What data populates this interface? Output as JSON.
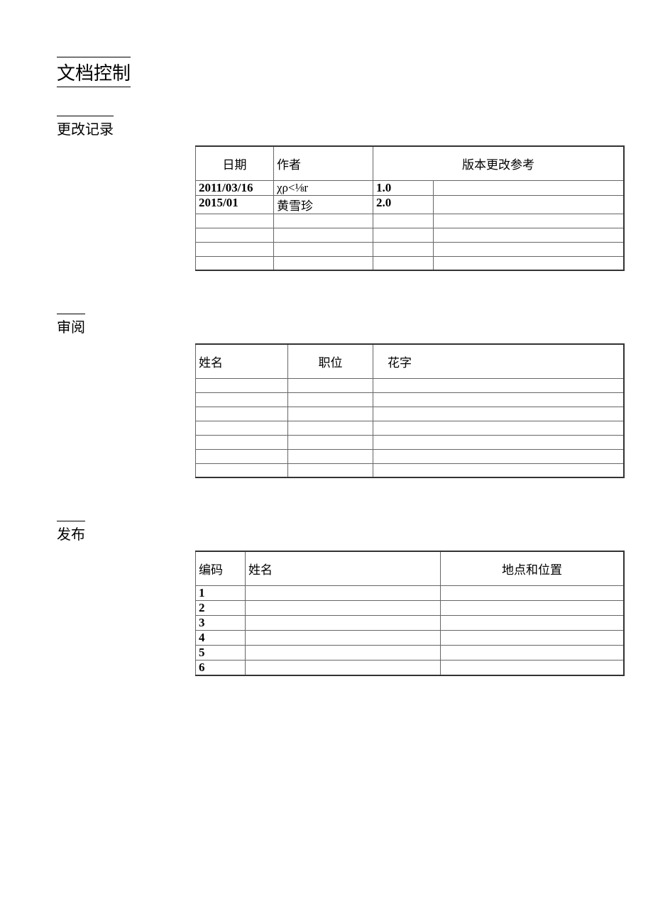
{
  "pageTitle": "文档控制",
  "sections": {
    "changeLog": {
      "title": "更改记录",
      "headers": [
        "日期",
        "作者",
        "版本更改参考",
        ""
      ],
      "rows": [
        {
          "date": "2011/03/16",
          "author": "χρ<⅛r",
          "version": "1.0",
          "ref": ""
        },
        {
          "date": "2015/01",
          "author": "黄雪珍",
          "version": "2.0",
          "ref": ""
        },
        {
          "date": "",
          "author": "",
          "version": "",
          "ref": ""
        },
        {
          "date": "",
          "author": "",
          "version": "",
          "ref": ""
        },
        {
          "date": "",
          "author": "",
          "version": "",
          "ref": ""
        },
        {
          "date": "",
          "author": "",
          "version": "",
          "ref": ""
        }
      ]
    },
    "review": {
      "title": "审阅",
      "headers": [
        "姓名",
        "职位",
        "花字"
      ],
      "rows": [
        {
          "name": "",
          "position": "",
          "sig": ""
        },
        {
          "name": "",
          "position": "",
          "sig": ""
        },
        {
          "name": "",
          "position": "",
          "sig": ""
        },
        {
          "name": "",
          "position": "",
          "sig": ""
        },
        {
          "name": "",
          "position": "",
          "sig": ""
        },
        {
          "name": "",
          "position": "",
          "sig": ""
        },
        {
          "name": "",
          "position": "",
          "sig": ""
        }
      ]
    },
    "publish": {
      "title": "发布",
      "headers": [
        "编码",
        "姓名",
        "地点和位置"
      ],
      "rows": [
        {
          "code": "1",
          "name": "",
          "loc": ""
        },
        {
          "code": "2",
          "name": "",
          "loc": ""
        },
        {
          "code": "3",
          "name": "",
          "loc": ""
        },
        {
          "code": "4",
          "name": "",
          "loc": ""
        },
        {
          "code": "5",
          "name": "",
          "loc": ""
        },
        {
          "code": "6",
          "name": "",
          "loc": ""
        }
      ]
    }
  }
}
